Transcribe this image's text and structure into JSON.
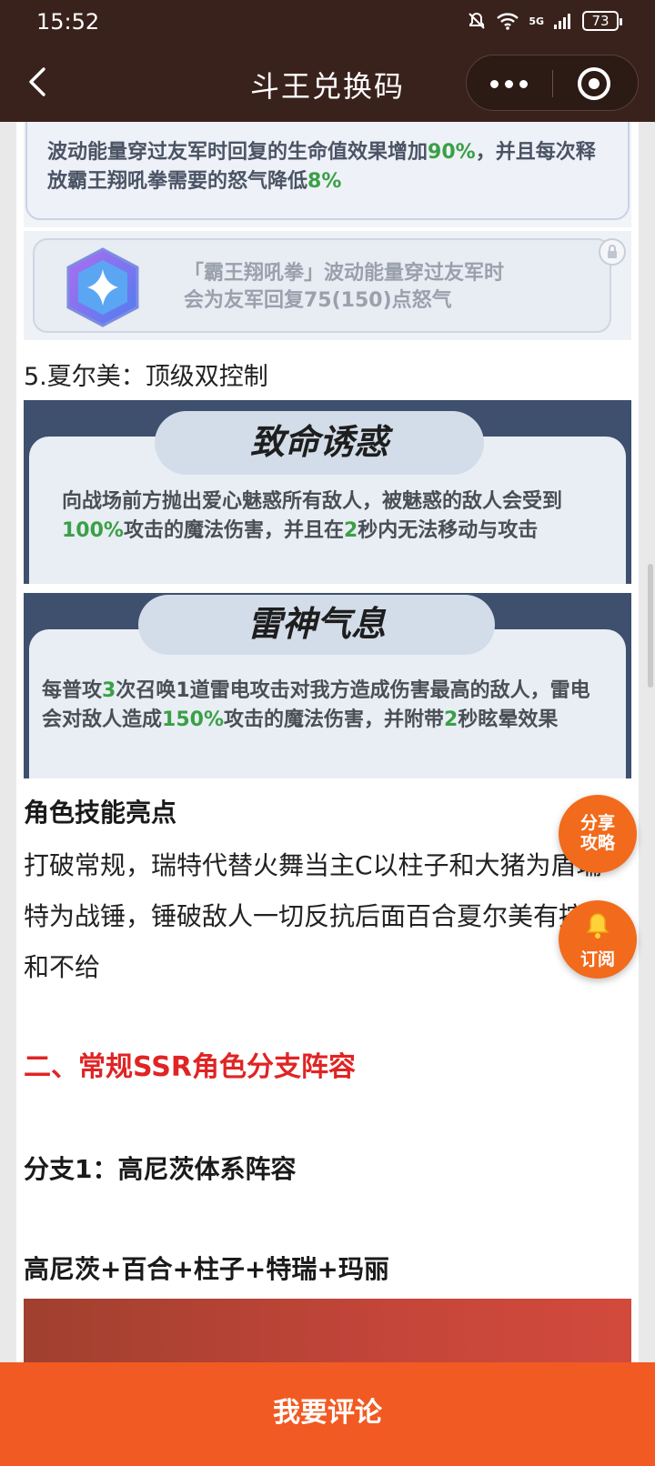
{
  "status_bar": {
    "time": "15:52",
    "network": "5G",
    "battery": "73"
  },
  "nav": {
    "title": "斗王兑换码"
  },
  "article": {
    "card1_prefix": "波动能量穿过友军时回复的生命值效果增加",
    "card1_value1": "90%",
    "card1_middle": "，并且每次释放霸王翔吼拳需要的怒气降低",
    "card1_value2": "8%",
    "card2_line1": "「霸王翔吼拳」波动能量穿过友军时",
    "card2_line2": "会为友军回复75(150)点怒气",
    "section5_title": "5.夏尔美：顶级双控制",
    "skill1": {
      "name": "致命诱惑",
      "desc_a": "向战场前方抛出爱心魅惑所有敌人，被魅惑的敌人会受到",
      "value1": "100%",
      "desc_b": "攻击的魔法伤害，并且在",
      "value2": "2",
      "desc_c": "秒内无法移动与攻击"
    },
    "skill2": {
      "name": "雷神气息",
      "desc_a": "每普攻",
      "value1": "3",
      "desc_b": "次召唤1道雷电攻击对我方造成伤害最高的敌人，雷电会对敌人造成",
      "value2": "150%",
      "desc_c": "攻击的魔法伤害，并附带",
      "value3": "2",
      "desc_d": "秒眩晕效果"
    },
    "highlight_title": "角色技能亮点",
    "highlight_text": "打破常规，瑞特代替火舞当主C以柱子和大猪为盾瑞特为战锤，锤破敌人一切反抗后面百合夏尔美有控制和不给",
    "section2_title": "二、常规SSR角色分支阵容",
    "branch1_title": "分支1：高尼茨体系阵容",
    "lineup_title": "高尼茨+百合+柱子+特瑞+玛丽"
  },
  "fab": {
    "share_line1": "分享",
    "share_line2": "攻略",
    "subscribe": "订阅"
  },
  "bottom": {
    "comment_label": "我要评论"
  },
  "colors": {
    "nav_bg": "#3a221c",
    "accent_orange": "#f15a22",
    "highlight_green": "#3aa046",
    "section_red": "#e02424"
  }
}
